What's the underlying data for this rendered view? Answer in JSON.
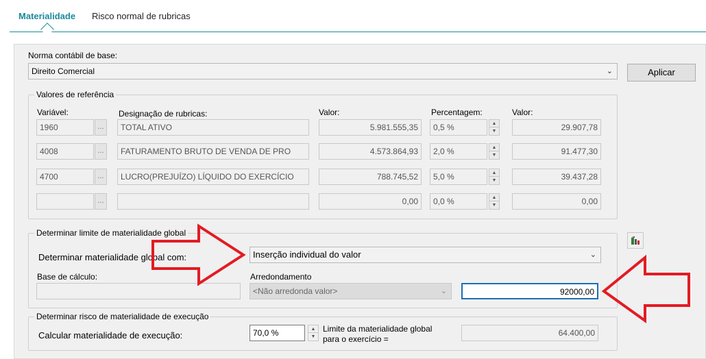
{
  "tabs": [
    "Materialidade",
    "Risco normal de rubricas"
  ],
  "norma": {
    "label": "Norma contábil de base:",
    "value": "Direito Comercial",
    "apply_button": "Aplicar"
  },
  "reference": {
    "title": "Valores de referência",
    "headers": {
      "variable": "Variável:",
      "designation": "Designação de rubricas:",
      "value": "Valor:",
      "percentage": "Percentagem:",
      "result": "Valor:"
    },
    "dots": "...",
    "rows": [
      {
        "variable": "1960",
        "designation": "TOTAL ATIVO",
        "value": "5.981.555,35",
        "percentage": "0,5  %",
        "result": "29.907,78"
      },
      {
        "variable": "4008",
        "designation": "FATURAMENTO BRUTO DE VENDA DE PRO",
        "value": "4.573.864,93",
        "percentage": "2,0  %",
        "result": "91.477,30"
      },
      {
        "variable": "4700",
        "designation": "LUCRO(PREJUÍZO) LÍQUIDO DO EXERCÍCIO",
        "value": "788.745,52",
        "percentage": "5,0  %",
        "result": "39.437,28"
      },
      {
        "variable": "",
        "designation": "",
        "value": "0,00",
        "percentage": "0,0  %",
        "result": "0,00"
      }
    ]
  },
  "global_limit": {
    "title": "Determinar limite de materialidade global",
    "method_label": "Determinar materialidade global com:",
    "method_value": "Inserção individual do valor",
    "base_label": "Base de cálculo:",
    "rounding_label": "Arredondamento",
    "rounding_value": "<Não arredonda valor>",
    "input_value": "92000,00"
  },
  "execution": {
    "title": "Determinar risco de materialidade de execução",
    "calc_label": "Calcular materialidade de execução:",
    "percent_value": "70,0  %",
    "limit_label_line1": "Limite da materialidade global",
    "limit_label_line2": "para o exercício =",
    "limit_value": "64.400,00"
  },
  "colors": {
    "accent": "#1b8a9a",
    "annotation_arrow": "#e31b23"
  }
}
